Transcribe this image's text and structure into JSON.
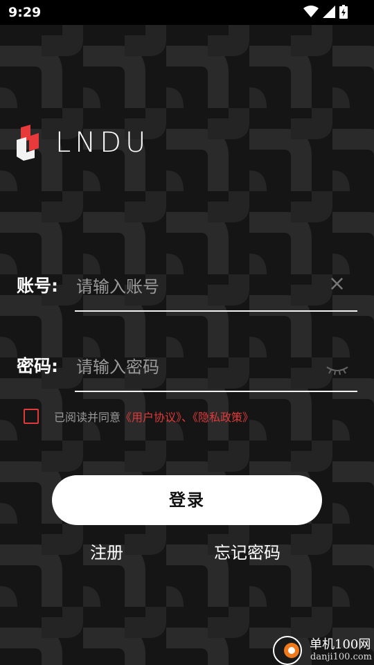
{
  "status": {
    "time": "9:29"
  },
  "logo": {
    "text": "LNDU"
  },
  "account": {
    "label": "账号:",
    "placeholder": "请输入账号"
  },
  "password": {
    "label": "密码:",
    "placeholder": "请输入密码"
  },
  "agreement": {
    "prefix": "已阅读并同意",
    "user_agreement": "《用户协议》",
    "separator": "、",
    "privacy_policy": "《隐私政策》"
  },
  "actions": {
    "login": "登录",
    "register": "注册",
    "forgot": "忘记密码"
  },
  "colors": {
    "accent": "#e03a3a",
    "background": "#151515"
  },
  "watermark": {
    "title": "单机100网",
    "subtitle": "danji100.com"
  }
}
